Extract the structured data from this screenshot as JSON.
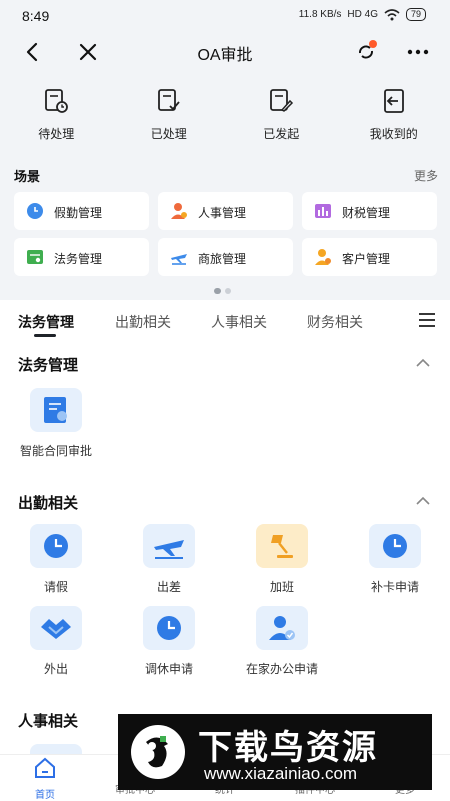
{
  "status_bar": {
    "time": "8:49",
    "net_speed": "11.8 KB/s",
    "signal": "HD 4G",
    "battery": "79"
  },
  "nav": {
    "title": "OA审批"
  },
  "quick_actions": [
    {
      "label": "待处理",
      "icon": "pending-clock-icon"
    },
    {
      "label": "已处理",
      "icon": "processed-check-icon"
    },
    {
      "label": "已发起",
      "icon": "initiated-edit-icon"
    },
    {
      "label": "我收到的",
      "icon": "received-inbox-icon"
    }
  ],
  "scene": {
    "title": "场景",
    "more": "更多",
    "cards": [
      {
        "label": "假勤管理",
        "icon": "clock-icon"
      },
      {
        "label": "人事管理",
        "icon": "person-icon"
      },
      {
        "label": "财税管理",
        "icon": "chart-icon"
      },
      {
        "label": "法务管理",
        "icon": "document-icon"
      },
      {
        "label": "商旅管理",
        "icon": "plane-icon"
      },
      {
        "label": "客户管理",
        "icon": "customer-icon"
      }
    ]
  },
  "tabs": [
    "法务管理",
    "出勤相关",
    "人事相关",
    "财务相关"
  ],
  "sections": {
    "legal": {
      "title": "法务管理",
      "apps": [
        {
          "label": "智能合同审批"
        }
      ]
    },
    "attendance": {
      "title": "出勤相关",
      "apps": [
        {
          "label": "请假"
        },
        {
          "label": "出差"
        },
        {
          "label": "加班"
        },
        {
          "label": "补卡申请"
        },
        {
          "label": "外出"
        },
        {
          "label": "调休申请"
        },
        {
          "label": "在家办公申请"
        }
      ]
    },
    "hr": {
      "title": "人事相关"
    }
  },
  "bottom_nav": [
    "首页",
    "审批中心",
    "统计",
    "插件中心",
    "更多"
  ],
  "watermark": {
    "big": "下载鸟资源",
    "url": "www.xiazainiao.com"
  },
  "colors": {
    "accent": "#2d6fe6",
    "panel_bg": "#f2f4f7",
    "icon_bg": "#e6f0fc",
    "badge": "#ff5a2b"
  }
}
